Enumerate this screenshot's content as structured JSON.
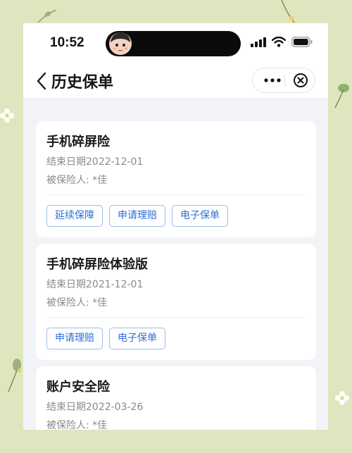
{
  "status_bar": {
    "time": "10:52"
  },
  "nav": {
    "title": "历史保单"
  },
  "icons": {
    "back": "chevron-left-icon",
    "more": "more-dots-icon",
    "close": "close-circle-icon",
    "signal": "cellular-signal-icon",
    "wifi": "wifi-icon",
    "battery": "battery-icon"
  },
  "colors": {
    "accent": "#2d6fd8",
    "pill_border": "#9dbcf0",
    "page_background": "#f2f3f7",
    "backdrop": "#dfe6bf"
  },
  "policies": [
    {
      "title": "手机碎屏险",
      "end_date": "结束日期2022-12-01",
      "insured": "被保险人: *佳",
      "buttons": [
        "延续保障",
        "申请理赔",
        "电子保单"
      ]
    },
    {
      "title": "手机碎屏险体验版",
      "end_date": "结束日期2021-12-01",
      "insured": "被保险人: *佳",
      "buttons": [
        "申请理赔",
        "电子保单"
      ]
    },
    {
      "title": "账户安全险",
      "end_date": "结束日期2022-03-26",
      "insured": "被保险人: *佳",
      "buttons": []
    }
  ]
}
